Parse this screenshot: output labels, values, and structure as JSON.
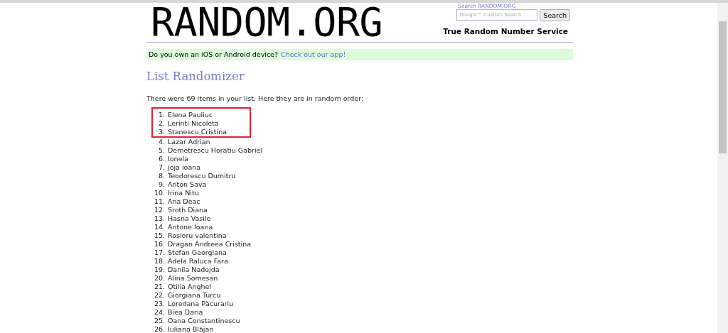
{
  "header": {
    "logo": "RANDOM.ORG",
    "search_label": "Search RANDOM.ORG",
    "search": {
      "placeholder": "Google™ Custom Search"
    },
    "search_button": "Search",
    "tagline": "True Random Number Service"
  },
  "banner": {
    "text": "Do you own an iOS or Android device?",
    "link": "Check out our app!"
  },
  "title": "List Randomizer",
  "intro": "There were 69 items in your list. Here they are in random order:",
  "items": [
    {
      "number": "1.",
      "name": "Elena Pauliuc"
    },
    {
      "number": "2.",
      "name": "Lerinti Nicoleta"
    },
    {
      "number": "3.",
      "name": "Stanescu Cristina"
    },
    {
      "number": "4.",
      "name": "Lazar Adrian"
    },
    {
      "number": "5.",
      "name": "Demetrescu Horatiu Gabriel"
    },
    {
      "number": "6.",
      "name": "Ionela"
    },
    {
      "number": "7.",
      "name": "joja ioana"
    },
    {
      "number": "8.",
      "name": "Teodorescu Dumitru"
    },
    {
      "number": "9.",
      "name": "Anton Sava"
    },
    {
      "number": "10.",
      "name": "Irina Nitu"
    },
    {
      "number": "11.",
      "name": "Ana Deac"
    },
    {
      "number": "12.",
      "name": "Sroth Diana"
    },
    {
      "number": "13.",
      "name": "Hasna Vasile"
    },
    {
      "number": "14.",
      "name": "Antone Ioana"
    },
    {
      "number": "15.",
      "name": "Rosioru valentina"
    },
    {
      "number": "16.",
      "name": "Dragan Andreea Cristina"
    },
    {
      "number": "17.",
      "name": "Stefan Georgiana"
    },
    {
      "number": "18.",
      "name": "Adela Raluca Fara"
    },
    {
      "number": "19.",
      "name": "Danila Nadejda"
    },
    {
      "number": "20.",
      "name": "Alina Somesan"
    },
    {
      "number": "21.",
      "name": "Otilia Anghel"
    },
    {
      "number": "22.",
      "name": "Giorgiana Turcu"
    },
    {
      "number": "23.",
      "name": "Loredana Păcurariu"
    },
    {
      "number": "24.",
      "name": "Biea Daria"
    },
    {
      "number": "25.",
      "name": "Oana Constantinescu"
    },
    {
      "number": "26.",
      "name": "Iuliana Blăjan"
    }
  ]
}
